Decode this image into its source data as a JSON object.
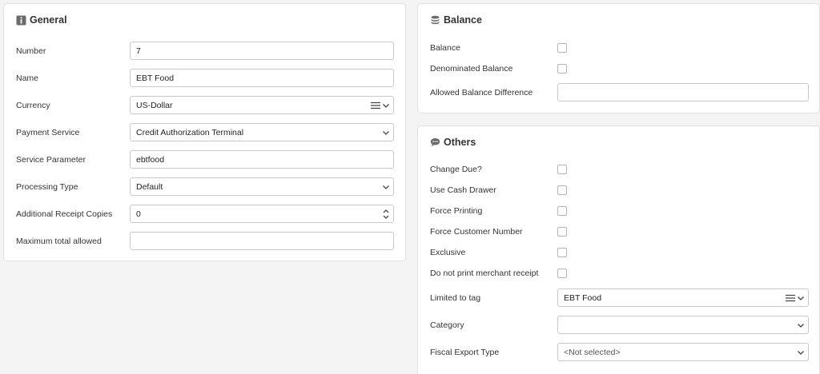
{
  "general": {
    "title": "General",
    "number": {
      "label": "Number",
      "value": "7"
    },
    "name": {
      "label": "Name",
      "value": "EBT Food"
    },
    "currency": {
      "label": "Currency",
      "value": "US-Dollar"
    },
    "payment_service": {
      "label": "Payment Service",
      "value": "Credit Authorization Terminal"
    },
    "service_parameter": {
      "label": "Service Parameter",
      "value": "ebtfood"
    },
    "processing_type": {
      "label": "Processing Type",
      "value": "Default"
    },
    "additional_receipt_copies": {
      "label": "Additional Receipt Copies",
      "value": "0"
    },
    "maximum_total_allowed": {
      "label": "Maximum total allowed",
      "value": ""
    }
  },
  "balance": {
    "title": "Balance",
    "balance": {
      "label": "Balance",
      "checked": false
    },
    "denominated_balance": {
      "label": "Denominated Balance",
      "checked": false
    },
    "allowed_balance_difference": {
      "label": "Allowed Balance Difference",
      "value": ""
    }
  },
  "others": {
    "title": "Others",
    "change_due": {
      "label": "Change Due?",
      "checked": false
    },
    "use_cash_drawer": {
      "label": "Use Cash Drawer",
      "checked": false
    },
    "force_printing": {
      "label": "Force Printing",
      "checked": false
    },
    "force_customer_number": {
      "label": "Force Customer Number",
      "checked": false
    },
    "exclusive": {
      "label": "Exclusive",
      "checked": false
    },
    "do_not_print_merchant_receipt": {
      "label": "Do not print merchant receipt",
      "checked": false
    },
    "limited_to_tag": {
      "label": "Limited to tag",
      "value": "EBT Food"
    },
    "category": {
      "label": "Category",
      "value": ""
    },
    "fiscal_export_type": {
      "label": "Fiscal Export Type",
      "value": "<Not selected>"
    }
  },
  "icons": {
    "general": "info-icon",
    "balance": "coins-icon",
    "others": "speech-bubble-icon",
    "dropdown": "chevron-down-icon",
    "list": "list-icon",
    "spinner": "spinner-arrows-icon"
  },
  "colors": {
    "background": "#f4f4f4",
    "panel": "#ffffff",
    "border": "#c9c9c9"
  }
}
